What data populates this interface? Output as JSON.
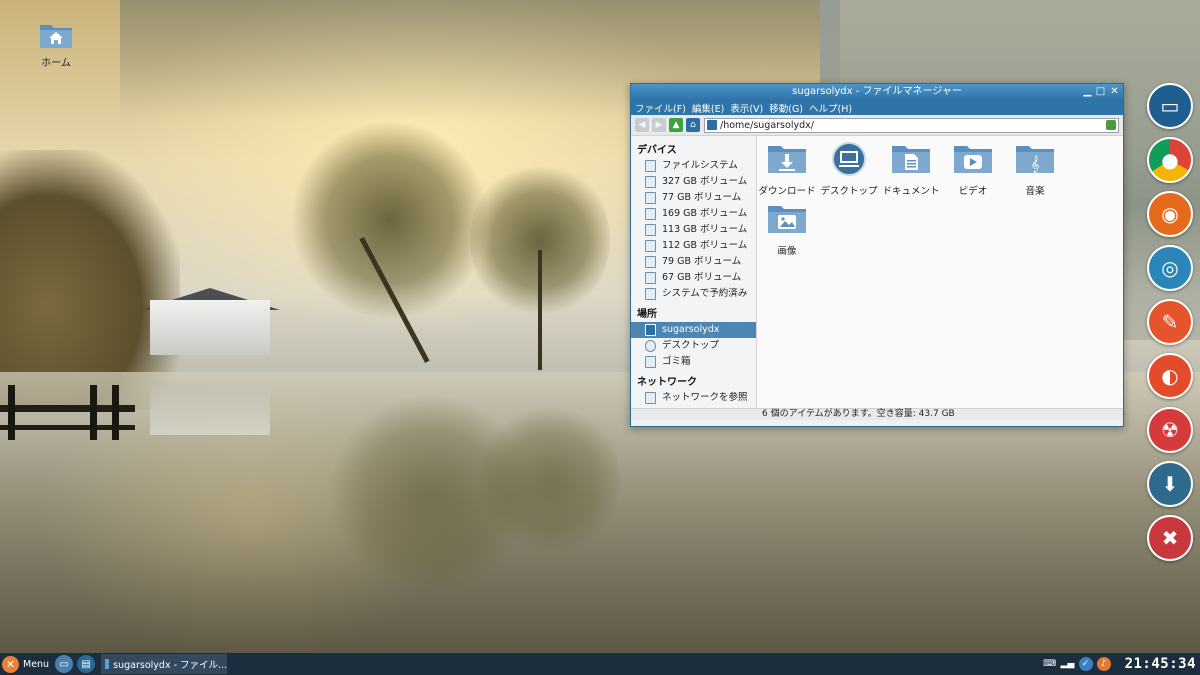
{
  "desktop": {
    "home_icon_label": "ホーム"
  },
  "window": {
    "title": "sugarsolydx - ファイルマネージャー",
    "menu": [
      "ファイル(F)",
      "編集(E)",
      "表示(V)",
      "移動(G)",
      "ヘルプ(H)"
    ],
    "address": "/home/sugarsolydx/",
    "sidebar": {
      "devices_heading": "デバイス",
      "devices": [
        "ファイルシステム",
        "327 GB ボリューム",
        "77 GB ボリューム",
        "169 GB ボリューム",
        "113 GB ボリューム",
        "112 GB ボリューム",
        "79 GB ボリューム",
        "67 GB ボリューム",
        "システムで予約済み"
      ],
      "places_heading": "場所",
      "places": [
        "sugarsolydx",
        "デスクトップ",
        "ゴミ箱"
      ],
      "network_heading": "ネットワーク",
      "network": [
        "ネットワークを参照"
      ]
    },
    "files": [
      {
        "label": "ダウンロード",
        "icon": "download-folder-icon"
      },
      {
        "label": "デスクトップ",
        "icon": "desktop-folder-icon"
      },
      {
        "label": "ドキュメント",
        "icon": "documents-folder-icon"
      },
      {
        "label": "ビデオ",
        "icon": "videos-folder-icon"
      },
      {
        "label": "音楽",
        "icon": "music-folder-icon"
      },
      {
        "label": "画像",
        "icon": "pictures-folder-icon"
      }
    ],
    "status": "6 個のアイテムがあります。空き容量: 43.7 GB"
  },
  "taskbar": {
    "menu_label": "Menu",
    "task_label": "sugarsolydx - ファイル...",
    "clock": "21:45:34"
  },
  "colors": {
    "accent": "#2f74a8",
    "selection": "#4d86b3",
    "taskbar": "#1c2d3d",
    "folder": "#7fa8cf"
  }
}
